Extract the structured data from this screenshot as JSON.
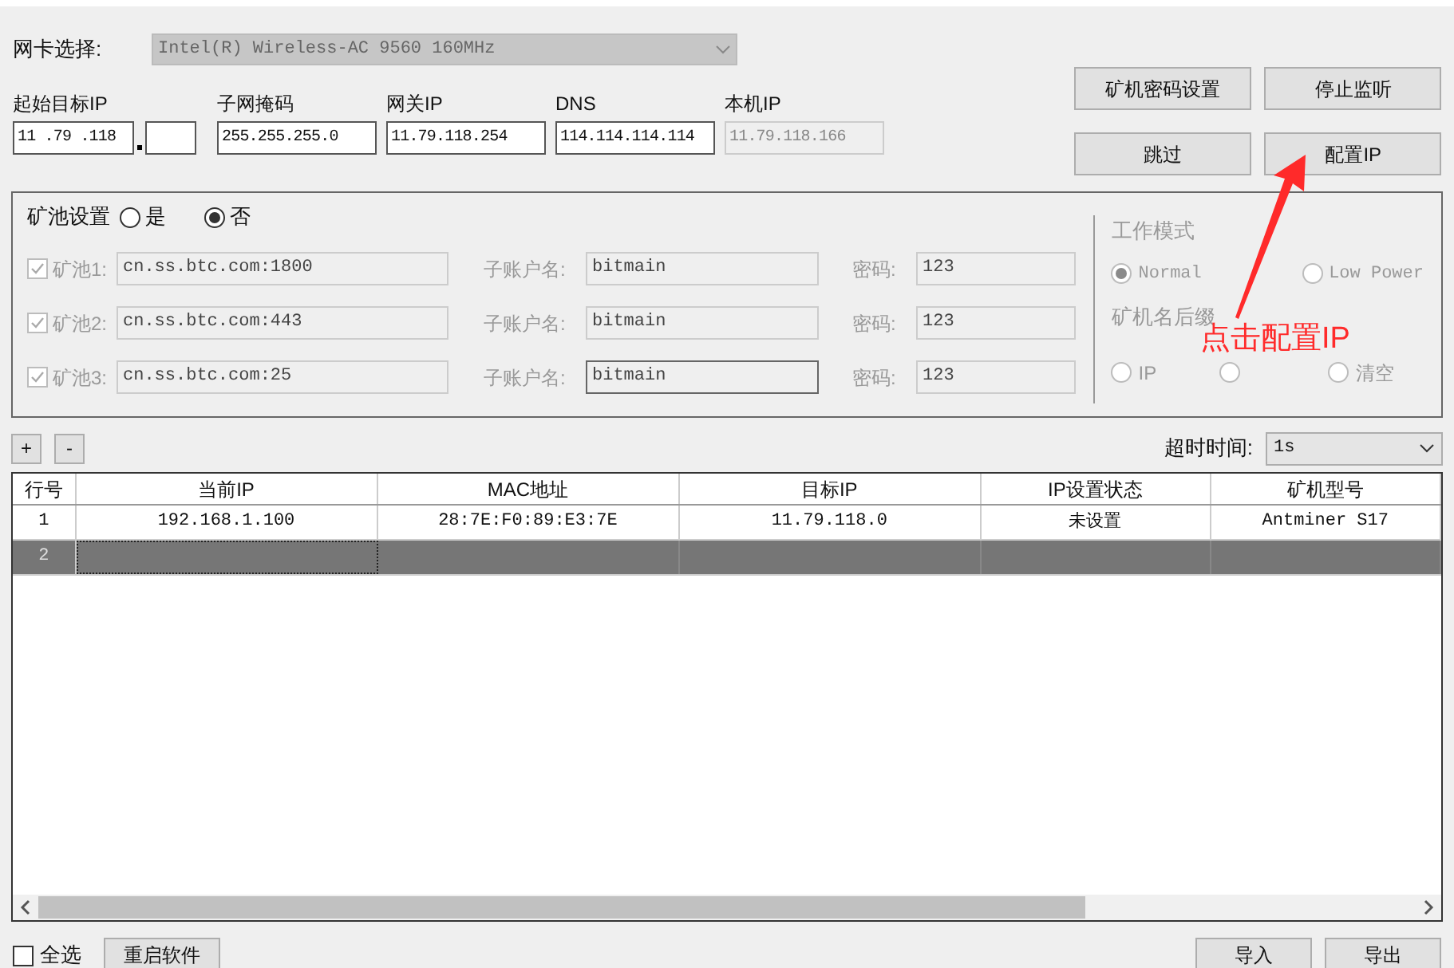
{
  "nic": {
    "label": "网卡选择:",
    "value": "Intel(R) Wireless-AC 9560 160MHz"
  },
  "ip_fields": [
    {
      "label": "起始目标IP",
      "value": "11 .79 .118",
      "kind": "start"
    },
    {
      "label": "子网掩码",
      "value": "255.255.255.0",
      "kind": "plain"
    },
    {
      "label": "网关IP",
      "value": "11.79.118.254",
      "kind": "plain"
    },
    {
      "label": "DNS",
      "value": "114.114.114.114",
      "kind": "plain"
    },
    {
      "label": "本机IP",
      "value": "11.79.118.166",
      "kind": "readonly"
    }
  ],
  "action_buttons": [
    "矿机密码设置",
    "停止监听",
    "跳过",
    "配置IP"
  ],
  "pool_settings": {
    "label": "矿池设置",
    "options": [
      {
        "label": "是",
        "selected": false
      },
      {
        "label": "否",
        "selected": true
      }
    ],
    "pools": [
      {
        "label": "矿池1:",
        "checked": true,
        "url": "cn.ss.btc.com:1800",
        "user_label": "子账户名:",
        "user": "bitmain",
        "password_label": "密码:",
        "password": "123"
      },
      {
        "label": "矿池2:",
        "checked": true,
        "url": "cn.ss.btc.com:443",
        "user_label": "子账户名:",
        "user": "bitmain",
        "password_label": "密码:",
        "password": "123"
      },
      {
        "label": "矿池3:",
        "checked": true,
        "url": "cn.ss.btc.com:25",
        "user_label": "子账户名:",
        "user": "bitmain",
        "password_label": "密码:",
        "password": "123"
      }
    ],
    "work_mode": {
      "label": "工作模式",
      "options": [
        {
          "label": "Normal",
          "selected": true
        },
        {
          "label": "Low Power",
          "selected": false
        }
      ]
    },
    "suffix": {
      "label": "矿机名后缀",
      "options": [
        {
          "label": "IP",
          "selected": false
        },
        {
          "selected": false
        },
        {
          "label": "清空",
          "selected": false
        }
      ]
    }
  },
  "row_buttons": [
    "+",
    "-"
  ],
  "timeout": {
    "label": "超时时间:",
    "value": "1s"
  },
  "table": {
    "columns": [
      "行号",
      "当前IP",
      "MAC地址",
      "目标IP",
      "IP设置状态",
      "矿机型号"
    ],
    "rows": [
      {
        "selected": false,
        "cells": [
          "1",
          "192.168.1.100",
          "28:7E:F0:89:E3:7E",
          "11.79.118.0",
          "未设置",
          "Antminer S17"
        ]
      },
      {
        "selected": true,
        "cells": [
          "2"
        ]
      }
    ]
  },
  "select_all": {
    "label": "全选",
    "checked": false
  },
  "restart_button": "重启软件",
  "footer_buttons": [
    "导入",
    "导出"
  ],
  "annotation": "点击配置IP"
}
